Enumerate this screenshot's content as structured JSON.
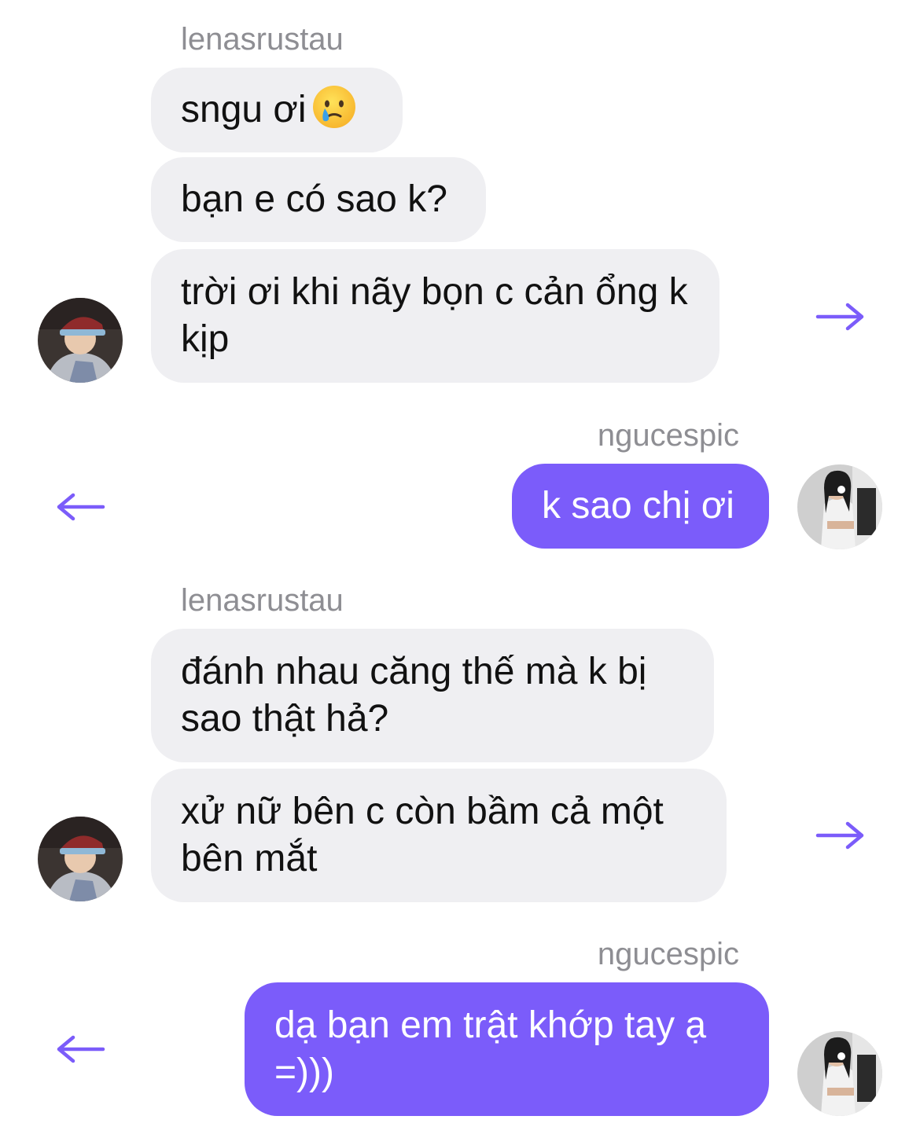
{
  "accent_color": "#7b5cfa",
  "incoming_bubble_color": "#efeff2",
  "sender_name_color": "#8e8e93",
  "groups": [
    {
      "direction": "incoming",
      "sender": "lenasrustau",
      "messages": [
        {
          "text": "sngu ơi",
          "emoji": "sad-but-relieved-face-emoji"
        },
        {
          "text": "bạn e có sao k?"
        },
        {
          "text": "trời ơi khi nãy bọn c cản ổng k kịp"
        }
      ],
      "action_icon": "arrow-right-icon"
    },
    {
      "direction": "outgoing",
      "sender": "ngucespic",
      "messages": [
        {
          "text": "k sao chị ơi"
        }
      ],
      "action_icon": "arrow-left-icon"
    },
    {
      "direction": "incoming",
      "sender": "lenasrustau",
      "messages": [
        {
          "text": "đánh nhau căng thế mà k bị sao thật hả?"
        },
        {
          "text": "xử nữ bên c còn bầm cả một bên mắt"
        }
      ],
      "action_icon": "arrow-right-icon"
    },
    {
      "direction": "outgoing",
      "sender": "ngucespic",
      "messages": [
        {
          "text": "dạ bạn em trật khớp tay ạ =)))"
        }
      ],
      "action_icon": "arrow-left-icon"
    }
  ]
}
